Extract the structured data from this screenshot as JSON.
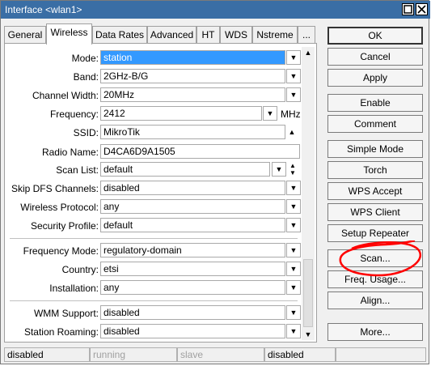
{
  "window": {
    "title": "Interface <wlan1>"
  },
  "tabs": [
    {
      "label": "General"
    },
    {
      "label": "Wireless"
    },
    {
      "label": "Data Rates"
    },
    {
      "label": "Advanced"
    },
    {
      "label": "HT"
    },
    {
      "label": "WDS"
    },
    {
      "label": "Nstreme"
    },
    {
      "label": "..."
    }
  ],
  "active_tab": "Wireless",
  "form": {
    "mode": {
      "label": "Mode:",
      "value": "station"
    },
    "band": {
      "label": "Band:",
      "value": "2GHz-B/G"
    },
    "channel_width": {
      "label": "Channel Width:",
      "value": "20MHz"
    },
    "frequency": {
      "label": "Frequency:",
      "value": "2412",
      "unit": "MHz"
    },
    "ssid": {
      "label": "SSID:",
      "value": "MikroTik"
    },
    "radio_name": {
      "label": "Radio Name:",
      "value": "D4CA6D9A1505"
    },
    "scan_list": {
      "label": "Scan List:",
      "value": "default"
    },
    "skip_dfs": {
      "label": "Skip DFS Channels:",
      "value": "disabled"
    },
    "wireless_protocol": {
      "label": "Wireless Protocol:",
      "value": "any"
    },
    "security_profile": {
      "label": "Security Profile:",
      "value": "default"
    },
    "frequency_mode": {
      "label": "Frequency Mode:",
      "value": "regulatory-domain"
    },
    "country": {
      "label": "Country:",
      "value": "etsi"
    },
    "installation": {
      "label": "Installation:",
      "value": "any"
    },
    "wmm_support": {
      "label": "WMM Support:",
      "value": "disabled"
    },
    "station_roaming": {
      "label": "Station Roaming:",
      "value": "disabled"
    }
  },
  "buttons": {
    "ok": "OK",
    "cancel": "Cancel",
    "apply": "Apply",
    "enable": "Enable",
    "comment": "Comment",
    "simple_mode": "Simple Mode",
    "torch": "Torch",
    "wps_accept": "WPS Accept",
    "wps_client": "WPS Client",
    "setup_repeater": "Setup Repeater",
    "scan": "Scan...",
    "freq_usage": "Freq. Usage...",
    "align": "Align...",
    "more": "More..."
  },
  "status": {
    "cell1": "disabled",
    "cell2": "running",
    "cell3": "slave",
    "cell4": "disabled",
    "cell5": ""
  },
  "icons": {
    "dropdown": "chevron-down-icon",
    "scroll_up": "arrow-up-icon",
    "scroll_down": "arrow-down-icon"
  },
  "colors": {
    "titlebar": "#3a6ea5",
    "selection": "#3399ff",
    "annotation": "#ff0000"
  }
}
